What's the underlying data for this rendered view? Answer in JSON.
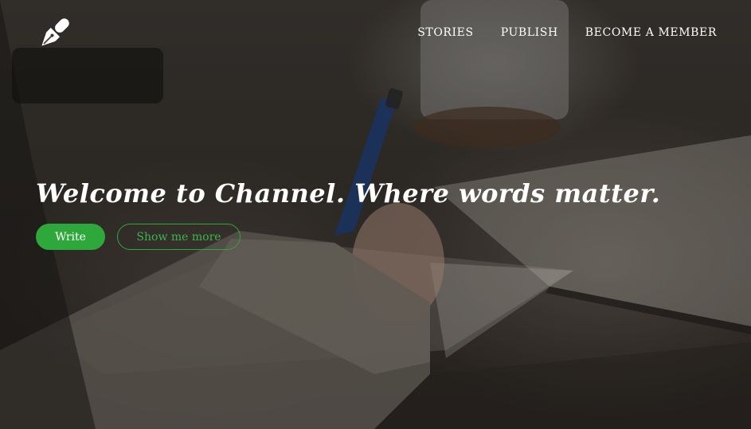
{
  "brand": {
    "logo_icon": "fountain-pen-nib-icon"
  },
  "nav": {
    "items": [
      {
        "label": "STORIES"
      },
      {
        "label": "PUBLISH"
      },
      {
        "label": "BECOME A MEMBER"
      }
    ]
  },
  "hero": {
    "headline": "Welcome to Channel. Where words matter.",
    "primary_button": "Write",
    "secondary_button": "Show me more"
  },
  "colors": {
    "accent": "#2fa83b",
    "text": "#ffffff"
  }
}
